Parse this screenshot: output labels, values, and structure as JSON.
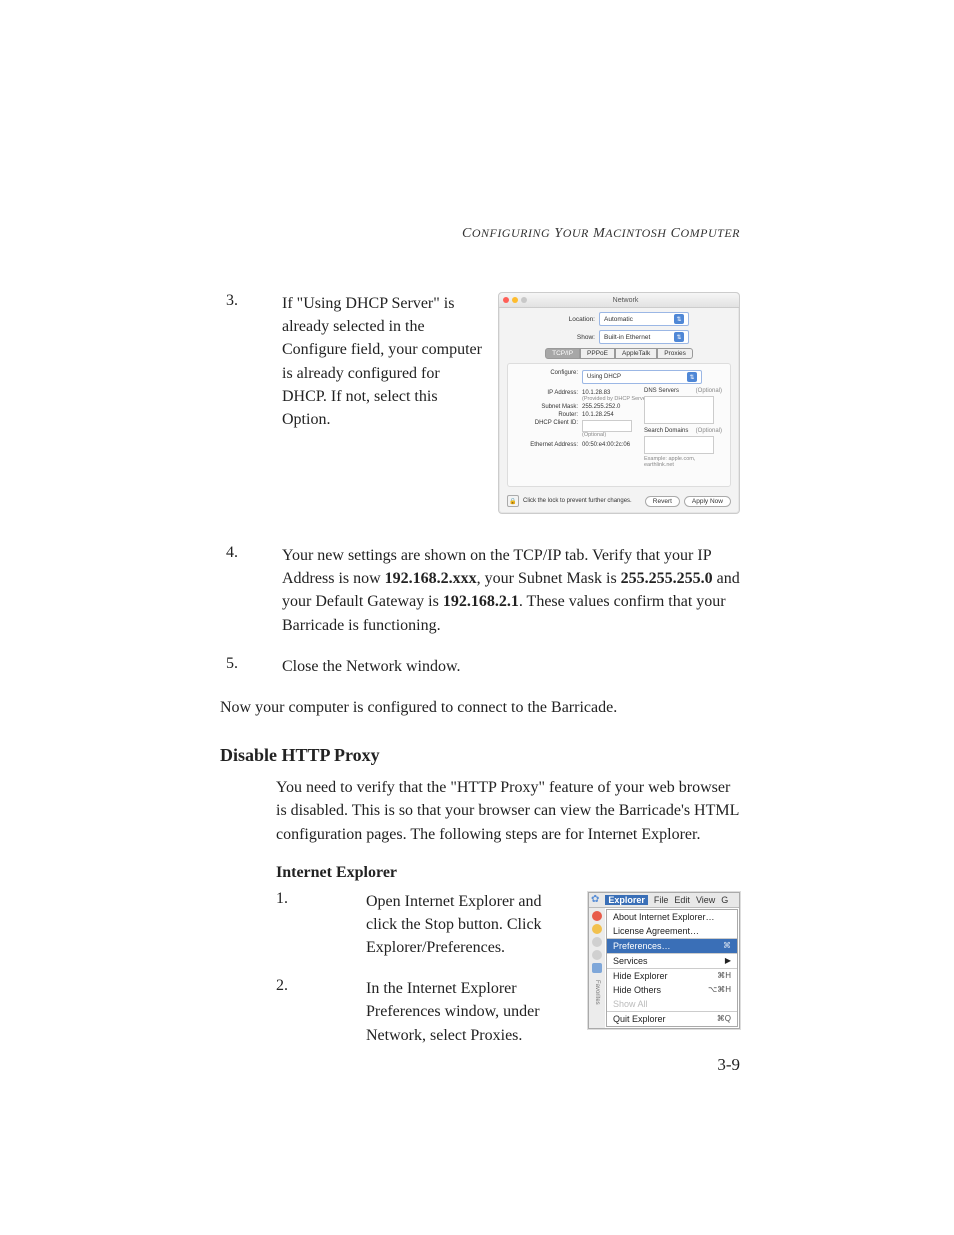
{
  "header": {
    "running": "Configuring Your Macintosh Computer"
  },
  "steps_a": [
    {
      "n": "3.",
      "text": "If \"Using DHCP Server\" is already selected in the Configure field, your computer is already configured for DHCP. If not, select this Option."
    }
  ],
  "steps_b": [
    {
      "n": "4.",
      "text_pre": "Your new settings are shown on the TCP/IP tab. Verify that your IP Address is now ",
      "b1": "192.168.2.xxx",
      "mid1": ", your Subnet Mask is ",
      "b2": "255.255.255.0",
      "mid2": " and your Default Gateway is ",
      "b3": "192.168.2.1",
      "post": ". These values confirm that your Barricade is functioning."
    },
    {
      "n": "5.",
      "text": "Close the Network window."
    }
  ],
  "para_now": "Now your computer is configured to connect to the Barricade.",
  "section": {
    "title": "Disable HTTP Proxy",
    "para": "You need to verify that the \"HTTP Proxy\" feature of your web browser is disabled. This is so that your browser can view the Barricade's HTML configuration pages. The following steps are for Internet Explorer."
  },
  "subsection": {
    "title": "Internet Explorer",
    "items": [
      {
        "n": "1.",
        "text": "Open Internet Explorer and click the Stop button. Click Explorer/Preferences."
      },
      {
        "n": "2.",
        "text": "In the Internet Explorer Preferences window, under Network, select Proxies."
      }
    ]
  },
  "page_number": "3-9",
  "fig_network": {
    "title": "Network",
    "location_lbl": "Location:",
    "location_val": "Automatic",
    "show_lbl": "Show:",
    "show_val": "Built-in Ethernet",
    "tabs": [
      "TCP/IP",
      "PPPoE",
      "AppleTalk",
      "Proxies"
    ],
    "configure_lbl": "Configure:",
    "configure_val": "Using DHCP",
    "ip_lbl": "IP Address:",
    "ip_val": "10.1.28.83",
    "ip_hint": "(Provided by DHCP Server)",
    "mask_lbl": "Subnet Mask:",
    "mask_val": "255.255.252.0",
    "router_lbl": "Router:",
    "router_val": "10.1.28.254",
    "client_lbl": "DHCP Client ID:",
    "client_hint": "(Optional)",
    "eth_lbl": "Ethernet Address:",
    "eth_val": "00:50:e4:00:2c:06",
    "dns_lbl": "DNS Servers",
    "dns_opt": "(Optional)",
    "search_lbl": "Search Domains",
    "search_opt": "(Optional)",
    "example": "Example: apple.com, earthlink.net",
    "lock_text": "Click the lock to prevent further changes.",
    "revert": "Revert",
    "apply": "Apply Now"
  },
  "fig_menu": {
    "menubar": {
      "app": "Explorer",
      "items": [
        "File",
        "Edit",
        "View",
        "G"
      ]
    },
    "items": {
      "about": "About Internet Explorer…",
      "license": "License Agreement…",
      "prefs": "Preferences…",
      "prefs_sc": "⌘",
      "services": "Services",
      "hide_exp": "Hide Explorer",
      "hide_exp_sc": "⌘H",
      "hide_oth": "Hide Others",
      "hide_oth_sc": "⌥⌘H",
      "show_all": "Show All",
      "quit": "Quit Explorer",
      "quit_sc": "⌘Q"
    }
  }
}
